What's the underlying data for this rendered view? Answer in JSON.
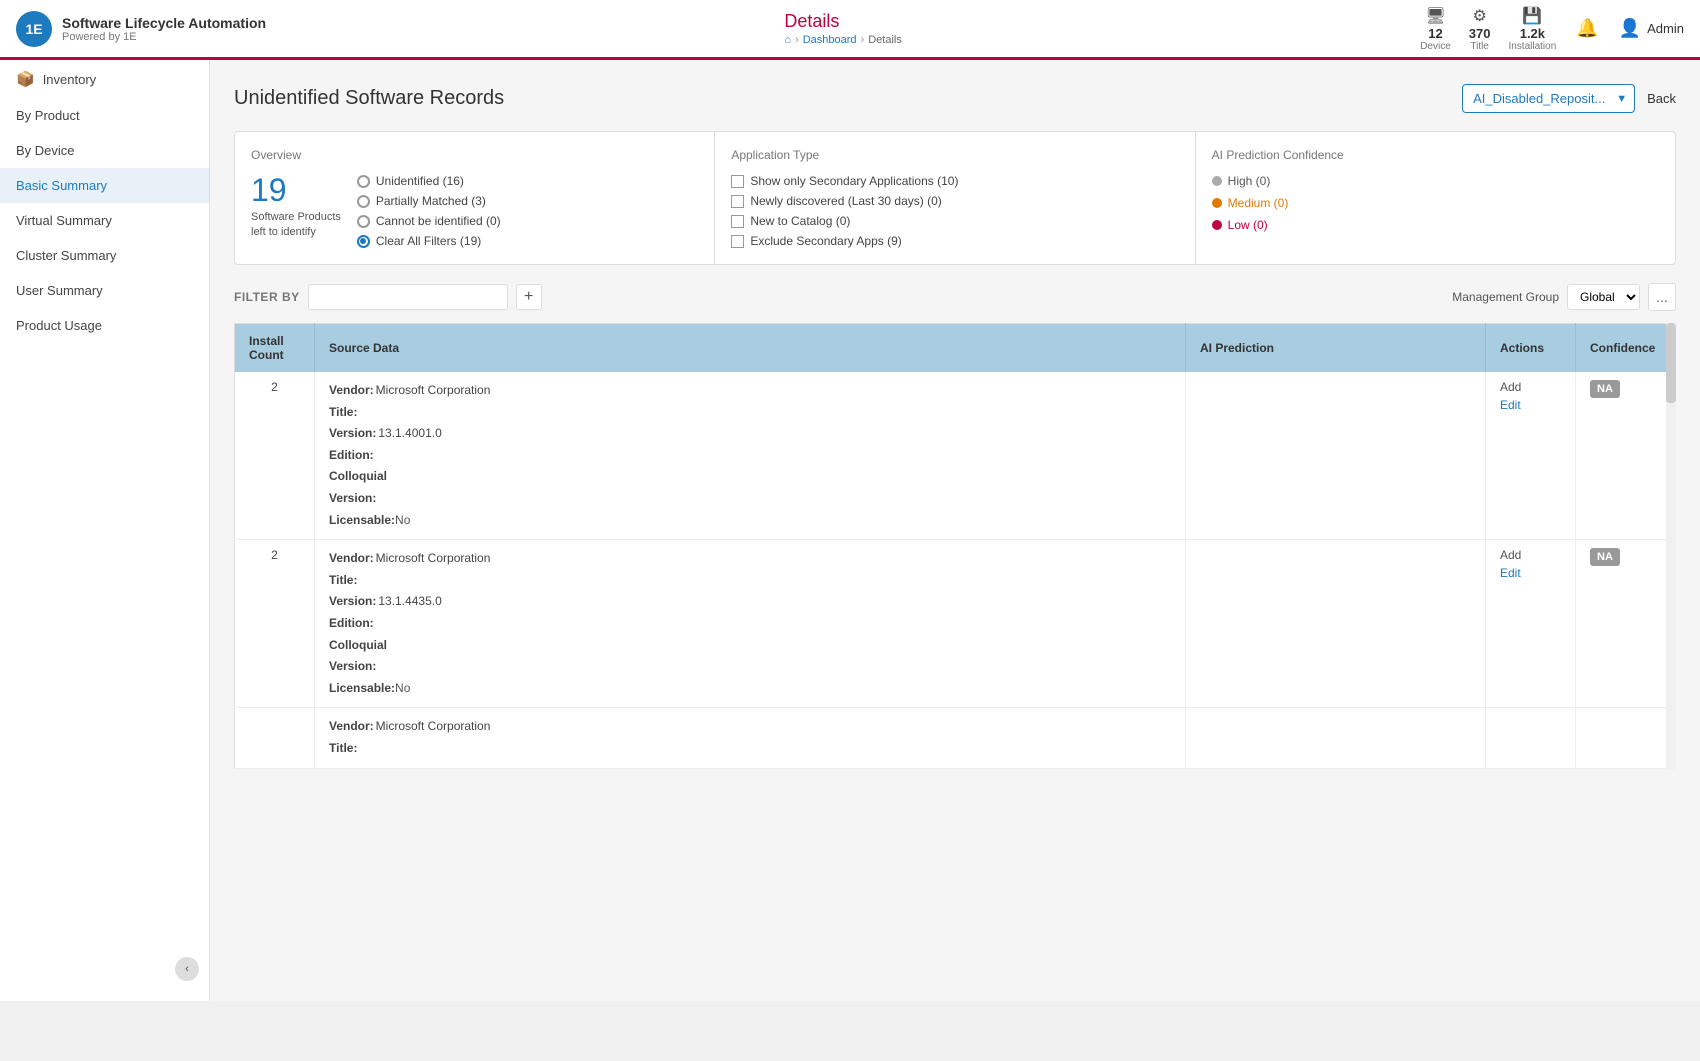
{
  "app": {
    "title": "Software Lifecycle Automation",
    "subtitle": "Powered by 1E",
    "logo_text": "1E"
  },
  "header": {
    "page_title": "Details",
    "breadcrumb": {
      "home": "⌂",
      "dashboard": "Dashboard",
      "current": "Details"
    },
    "stats": [
      {
        "icon": "🖥",
        "value": "12",
        "label": "Device"
      },
      {
        "icon": "⚙",
        "value": "370",
        "label": "Title"
      },
      {
        "icon": "💾",
        "value": "1.2k",
        "label": "Installation"
      }
    ],
    "admin_label": "Admin"
  },
  "sidebar": {
    "inventory_label": "Inventory",
    "items": [
      {
        "label": "By Product",
        "active": false
      },
      {
        "label": "By Device",
        "active": false
      },
      {
        "label": "Basic Summary",
        "active": true
      },
      {
        "label": "Virtual Summary",
        "active": false
      },
      {
        "label": "Cluster Summary",
        "active": false
      },
      {
        "label": "User Summary",
        "active": false
      },
      {
        "label": "Product Usage",
        "active": false
      }
    ],
    "collapse_icon": "‹"
  },
  "page": {
    "title": "Unidentified Software Records",
    "dropdown_value": "AI_Disabled_Reposit...",
    "back_label": "Back"
  },
  "overview_card": {
    "section_title": "Overview",
    "big_number": "19",
    "desc_line1": "Software Products",
    "desc_line2": "left to identify",
    "filters": [
      {
        "label": "Unidentified (16)",
        "selected": false
      },
      {
        "label": "Partially Matched (3)",
        "selected": false
      },
      {
        "label": "Cannot be identified (0)",
        "selected": false
      },
      {
        "label": "Clear All Filters (19)",
        "selected": true
      }
    ]
  },
  "app_type_card": {
    "section_title": "Application Type",
    "items": [
      {
        "label": "Show only Secondary Applications (10)"
      },
      {
        "label": "Newly discovered (Last 30 days) (0)"
      },
      {
        "label": "New to Catalog (0)"
      },
      {
        "label": "Exclude Secondary Apps (9)"
      }
    ]
  },
  "ai_confidence_card": {
    "section_title": "AI Prediction Confidence",
    "items": [
      {
        "label": "High (0)",
        "color": "gray",
        "class": "conf-high"
      },
      {
        "label": "Medium (0)",
        "color": "orange",
        "class": "conf-medium"
      },
      {
        "label": "Low (0)",
        "color": "red",
        "class": "conf-low"
      }
    ]
  },
  "filter_bar": {
    "label": "FILTER BY",
    "input_placeholder": "",
    "add_icon": "+",
    "mgmt_label": "Management Group",
    "mgmt_value": "Global",
    "more_icon": "..."
  },
  "table": {
    "headers": [
      {
        "label": "Install\nCount"
      },
      {
        "label": "Source Data"
      },
      {
        "label": "AI Prediction"
      },
      {
        "label": "Actions"
      },
      {
        "label": "Confidence"
      }
    ],
    "rows": [
      {
        "install_count": "2",
        "source_data": {
          "vendor": "Microsoft Corporation",
          "title": "",
          "version": "13.1.4001.0",
          "edition": "",
          "colloquial_version": "",
          "licensable": ""
        },
        "ai_prediction": "",
        "licensable_value": "No",
        "action_add": "Add",
        "action_edit": "Edit",
        "confidence": "NA"
      },
      {
        "install_count": "2",
        "source_data": {
          "vendor": "Microsoft Corporation",
          "title": "",
          "version": "13.1.4435.0",
          "edition": "",
          "colloquial_version": "",
          "licensable": ""
        },
        "ai_prediction": "",
        "licensable_value": "No",
        "action_add": "Add",
        "action_edit": "Edit",
        "confidence": "NA"
      },
      {
        "install_count": "",
        "source_data": {
          "vendor": "Microsoft Corporation",
          "title": "",
          "version": "",
          "edition": "",
          "colloquial_version": "",
          "licensable": ""
        },
        "ai_prediction": "",
        "licensable_value": "",
        "action_add": "",
        "action_edit": "",
        "confidence": ""
      }
    ]
  }
}
